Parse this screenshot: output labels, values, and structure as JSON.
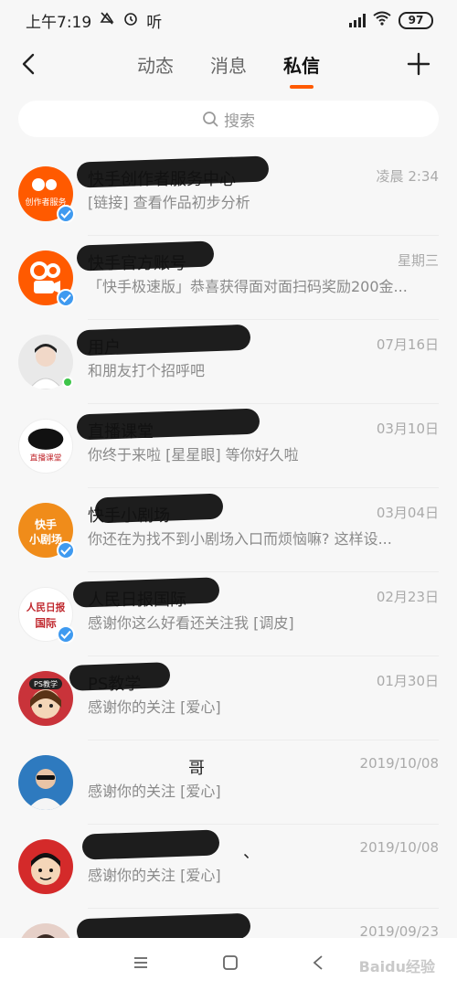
{
  "status_bar": {
    "time": "上午7:19",
    "audio_label": "听",
    "battery": "97"
  },
  "nav": {
    "tabs": [
      {
        "label": "动态",
        "active": false
      },
      {
        "label": "消息",
        "active": false
      },
      {
        "label": "私信",
        "active": true
      }
    ]
  },
  "search": {
    "placeholder": "搜索"
  },
  "conversations": [
    {
      "name": "快手创作者服务中心",
      "time": "凌晨 2:34",
      "message": "[链接] 查看作品初步分析",
      "avatar": "创作者服务",
      "avatar_color": "#ff5a00",
      "badge": "verified"
    },
    {
      "name": "快手官方账号",
      "time": "星期三",
      "message": "「快手极速版」恭喜获得面对面扫码奖励200金...",
      "avatar": "快手",
      "avatar_color": "#ff5a00",
      "badge": "verified"
    },
    {
      "name": "用户",
      "time": "07月16日",
      "message": "和朋友打个招呼吧",
      "avatar": "photo",
      "avatar_color": "#d8d8d8",
      "badge": "online"
    },
    {
      "name": "直播课堂",
      "time": "03月10日",
      "message": "你终于来啦 [星星眼] 等你好久啦",
      "avatar": "直播课堂",
      "avatar_color": "#ffffff",
      "badge": "none"
    },
    {
      "name": "快手小剧场",
      "time": "03月04日",
      "message": "你还在为找不到小剧场入口而烦恼嘛? 这样设...",
      "avatar": "快手小剧场",
      "avatar_color": "#f08c1a",
      "badge": "verified"
    },
    {
      "name": "人民日报国际",
      "time": "02月23日",
      "message": "感谢你这么好看还关注我 [调皮]",
      "avatar": "人民日报 国际",
      "avatar_color": "#ffffff",
      "badge": "verified"
    },
    {
      "name": "PS教学",
      "time": "01月30日",
      "message": "感谢你的关注 [爱心]",
      "avatar": "PS教学",
      "avatar_color": "#c9333a",
      "badge": "none"
    },
    {
      "name": "哥",
      "time": "2019/10/08",
      "message": "感谢你的关注 [爱心]",
      "avatar": "photo",
      "avatar_color": "#2e7abf",
      "badge": "none"
    },
    {
      "name": "、",
      "time": "2019/10/08",
      "message": "感谢你的关注 [爱心]",
      "avatar": "cartoon",
      "avatar_color": "#d42a2a",
      "badge": "none"
    },
    {
      "name": "",
      "time": "2019/09/23",
      "message": "",
      "avatar": "photo",
      "avatar_color": "#e6d0c8",
      "badge": "none"
    }
  ],
  "watermark": "Baidu经验"
}
